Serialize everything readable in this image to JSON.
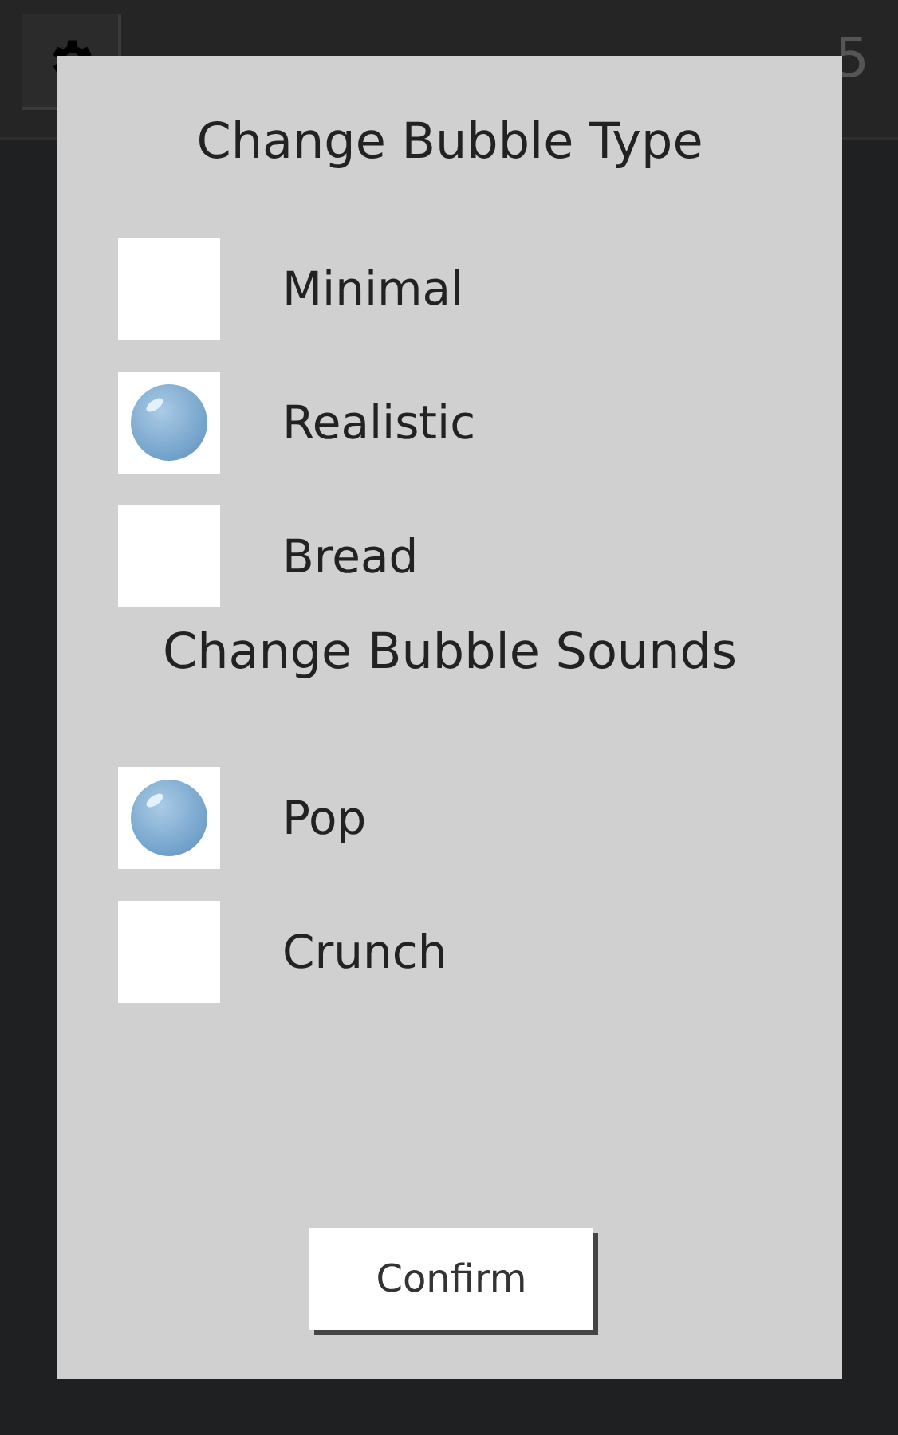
{
  "background": {
    "score": "5"
  },
  "dialog": {
    "sections": [
      {
        "title": "Change Bubble Type",
        "options": [
          {
            "label": "Minimal",
            "selected": false
          },
          {
            "label": "Realistic",
            "selected": true
          },
          {
            "label": "Bread",
            "selected": false
          }
        ]
      },
      {
        "title": "Change Bubble Sounds",
        "options": [
          {
            "label": "Pop",
            "selected": true
          },
          {
            "label": "Crunch",
            "selected": false
          }
        ]
      }
    ],
    "confirm_button": "Confirm"
  }
}
